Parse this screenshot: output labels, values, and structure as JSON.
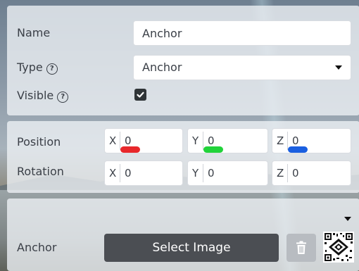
{
  "general": {
    "name_label": "Name",
    "name_value": "Anchor",
    "type_label": "Type",
    "type_value": "Anchor",
    "visible_label": "Visible",
    "visible_checked": true,
    "help_glyph": "?"
  },
  "transform": {
    "position_label": "Position",
    "rotation_label": "Rotation",
    "position": {
      "x": {
        "axis": "X",
        "value": "0",
        "marker_color": "#e8282b"
      },
      "y": {
        "axis": "Y",
        "value": "0",
        "marker_color": "#21d33a"
      },
      "z": {
        "axis": "Z",
        "value": "0",
        "marker_color": "#1a5fe0"
      }
    },
    "rotation": {
      "x": {
        "axis": "X",
        "value": "0"
      },
      "y": {
        "axis": "Y",
        "value": "0"
      },
      "z": {
        "axis": "Z",
        "value": "0"
      }
    }
  },
  "anchor": {
    "label": "Anchor",
    "select_image_label": "Select Image",
    "delete_icon": "trash-icon",
    "thumbnail_icon": "qr-code-icon",
    "collapse_icon": "chevron-down-icon"
  }
}
